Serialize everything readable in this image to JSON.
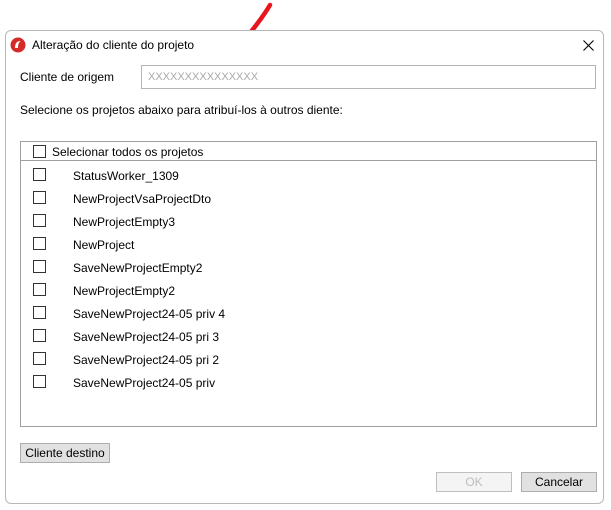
{
  "window": {
    "title": "Alteração do cliente do projeto",
    "close_icon": "close-icon",
    "app_icon": "app-logo-icon"
  },
  "origin": {
    "label": "Cliente de origem",
    "value": "XXXXXXXXXXXXXXX"
  },
  "instruction": "Selecione os projetos abaixo para atribuí-los à outros diente:",
  "list": {
    "select_all_label": "Selecionar todos os projetos",
    "items": [
      {
        "label": "StatusWorker_1309"
      },
      {
        "label": "NewProjectVsaProjectDto"
      },
      {
        "label": "NewProjectEmpty3"
      },
      {
        "label": "NewProject"
      },
      {
        "label": "SaveNewProjectEmpty2"
      },
      {
        "label": "NewProjectEmpty2"
      },
      {
        "label": "SaveNewProject24-05 priv 4"
      },
      {
        "label": "SaveNewProject24-05 pri 3"
      },
      {
        "label": "SaveNewProject24-05 pri 2"
      },
      {
        "label": "SaveNewProject24-05 priv"
      }
    ]
  },
  "buttons": {
    "destination": "Cliente destino",
    "ok": "OK",
    "cancel": "Cancelar"
  },
  "colors": {
    "annotation_arrow": "#e8141e",
    "app_icon": "#d42a2a"
  }
}
